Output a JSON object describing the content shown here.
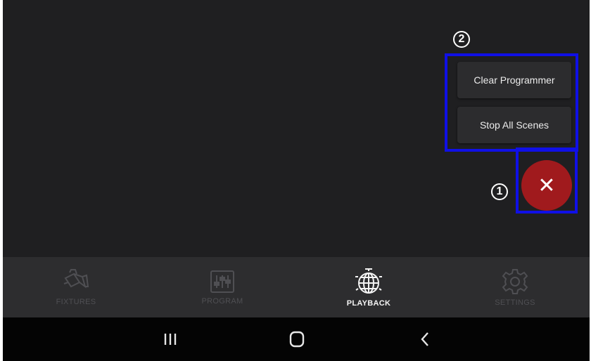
{
  "popup_menu": {
    "items": [
      {
        "label": "Clear Programmer"
      },
      {
        "label": "Stop All Scenes"
      }
    ]
  },
  "fab": {
    "icon": "close-icon",
    "color": "#a01a1d"
  },
  "annotations": [
    {
      "number": "1",
      "target": "fab"
    },
    {
      "number": "2",
      "target": "popup_menu"
    }
  ],
  "annotation_color": "#1010e6",
  "tabs": [
    {
      "label": "FIXTURES",
      "icon": "fixture-light-icon",
      "active": false
    },
    {
      "label": "PROGRAM",
      "icon": "sliders-icon",
      "active": false
    },
    {
      "label": "PLAYBACK",
      "icon": "disco-ball-icon",
      "active": true
    },
    {
      "label": "SETTINGS",
      "icon": "gear-icon",
      "active": false
    }
  ],
  "system_nav": [
    {
      "icon": "recent-apps-icon"
    },
    {
      "icon": "home-icon"
    },
    {
      "icon": "back-icon"
    }
  ]
}
